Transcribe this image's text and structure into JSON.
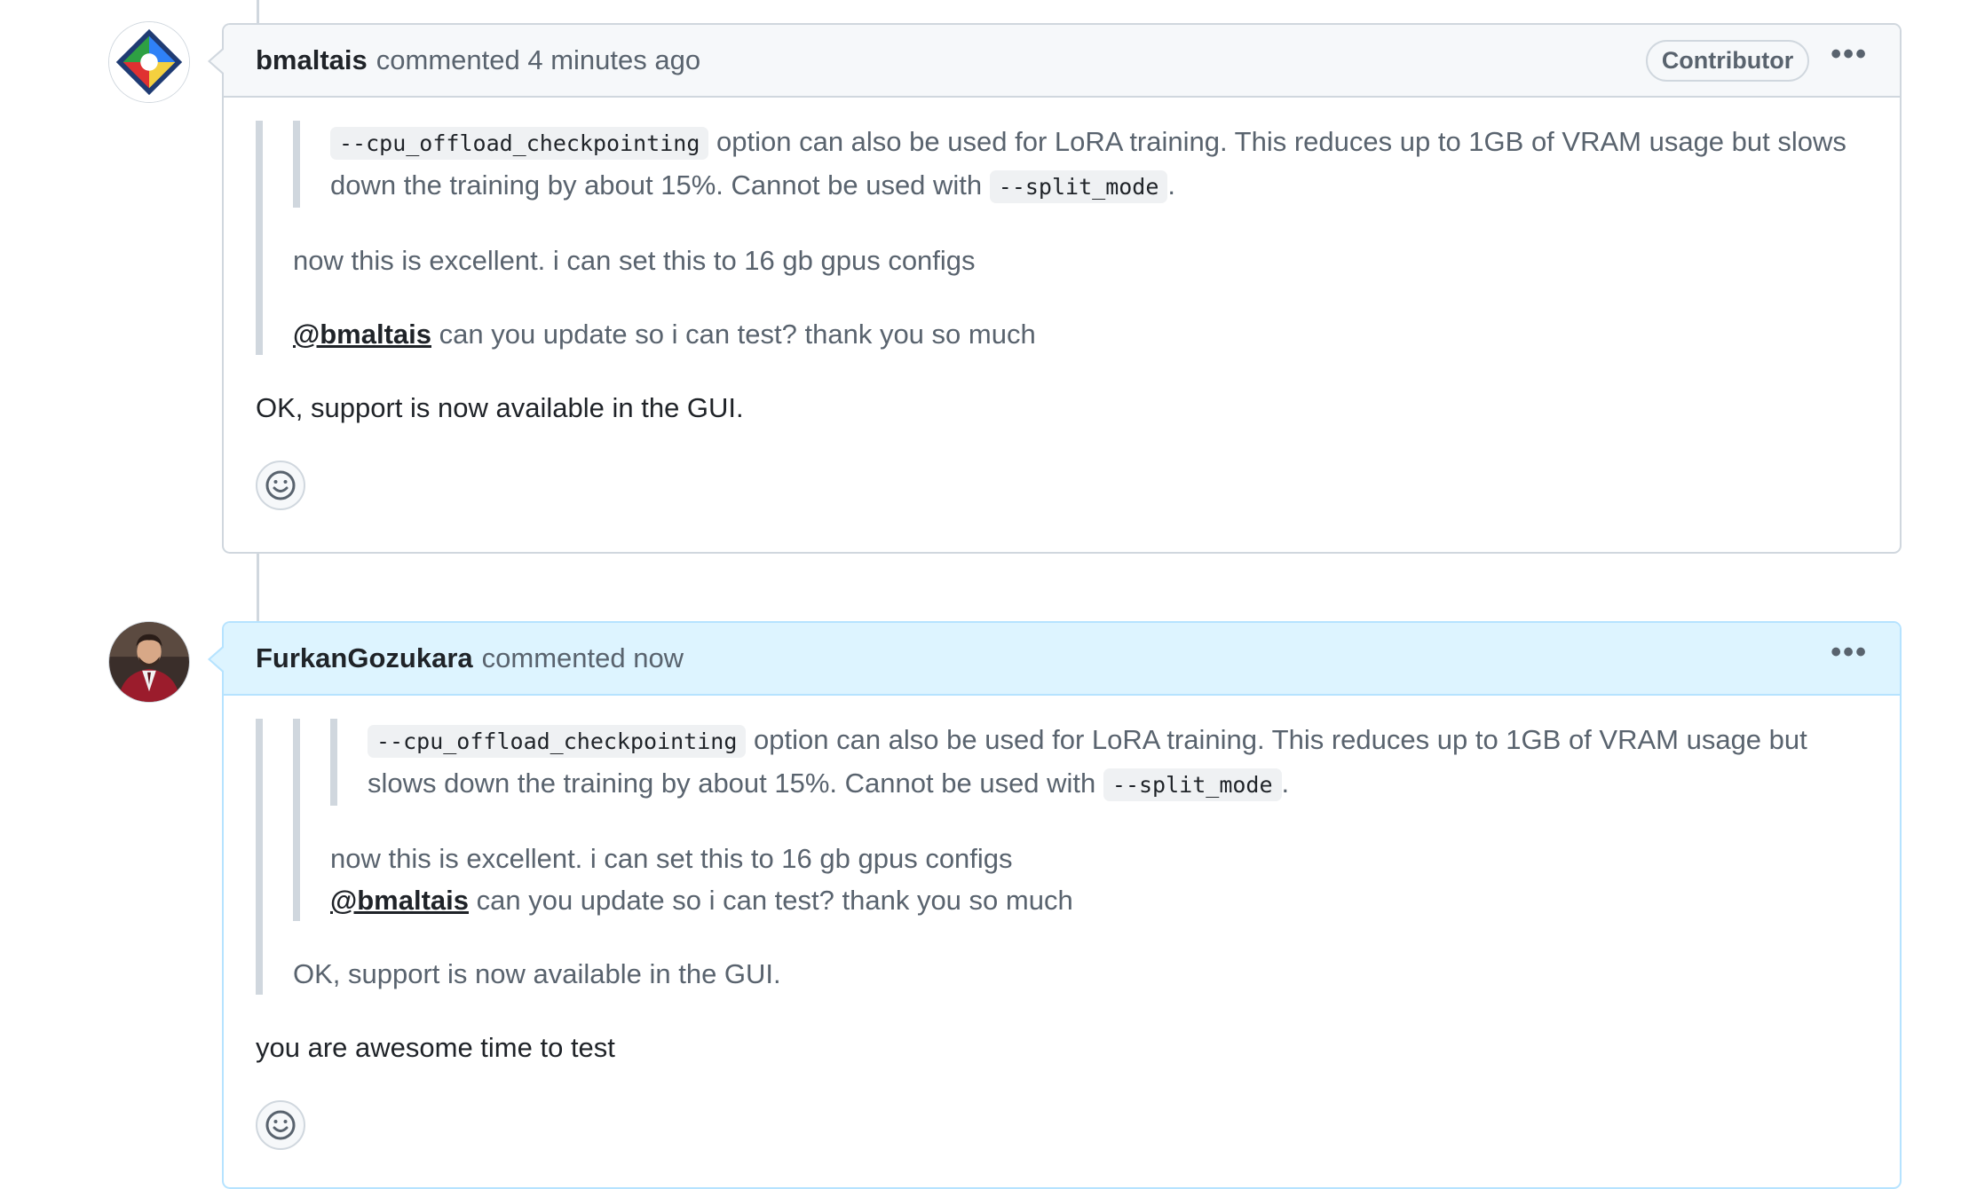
{
  "comments": [
    {
      "author": "bmaltais",
      "meta": "commented 4 minutes ago",
      "role_badge": "Contributor",
      "options_label": "•••",
      "quote": {
        "nested": {
          "code1": "--cpu_offload_checkpointing",
          "text1": " option can also be used for LoRA training. This reduces up to 1GB of VRAM usage but slows down the training by about 15%. Cannot be used with ",
          "code2": "--split_mode",
          "text2": "."
        },
        "line1": "now this is excellent. i can set this to 16 gb gpus configs",
        "mention": "@bmaltais",
        "line2": " can you update so i can test? thank you so much"
      },
      "body": "OK, support is now available in the GUI."
    },
    {
      "author": "FurkanGozukara",
      "meta": "commented now",
      "options_label": "•••",
      "quote": {
        "nested": {
          "code1": "--cpu_offload_checkpointing",
          "text1": " option can also be used for LoRA training. This reduces up to 1GB of VRAM usage but slows down the training by about 15%. Cannot be used with ",
          "code2": "--split_mode",
          "text2": "."
        },
        "line1": "now this is excellent. i can set this to 16 gb gpus configs",
        "mention": "@bmaltais",
        "line2": " can you update so i can test? thank you so much",
        "line3": "OK, support is now available in the GUI."
      },
      "body": "you are awesome time to test"
    }
  ],
  "colors": {
    "border": "#d0d7de",
    "header_bg": "#f6f8fa",
    "new_header_bg": "#ddf4ff",
    "new_border": "#b6e3ff",
    "text": "#1f2328",
    "muted": "#59636e"
  },
  "icons": {
    "reaction": "smiley-icon",
    "options": "kebab-horizontal-icon"
  }
}
